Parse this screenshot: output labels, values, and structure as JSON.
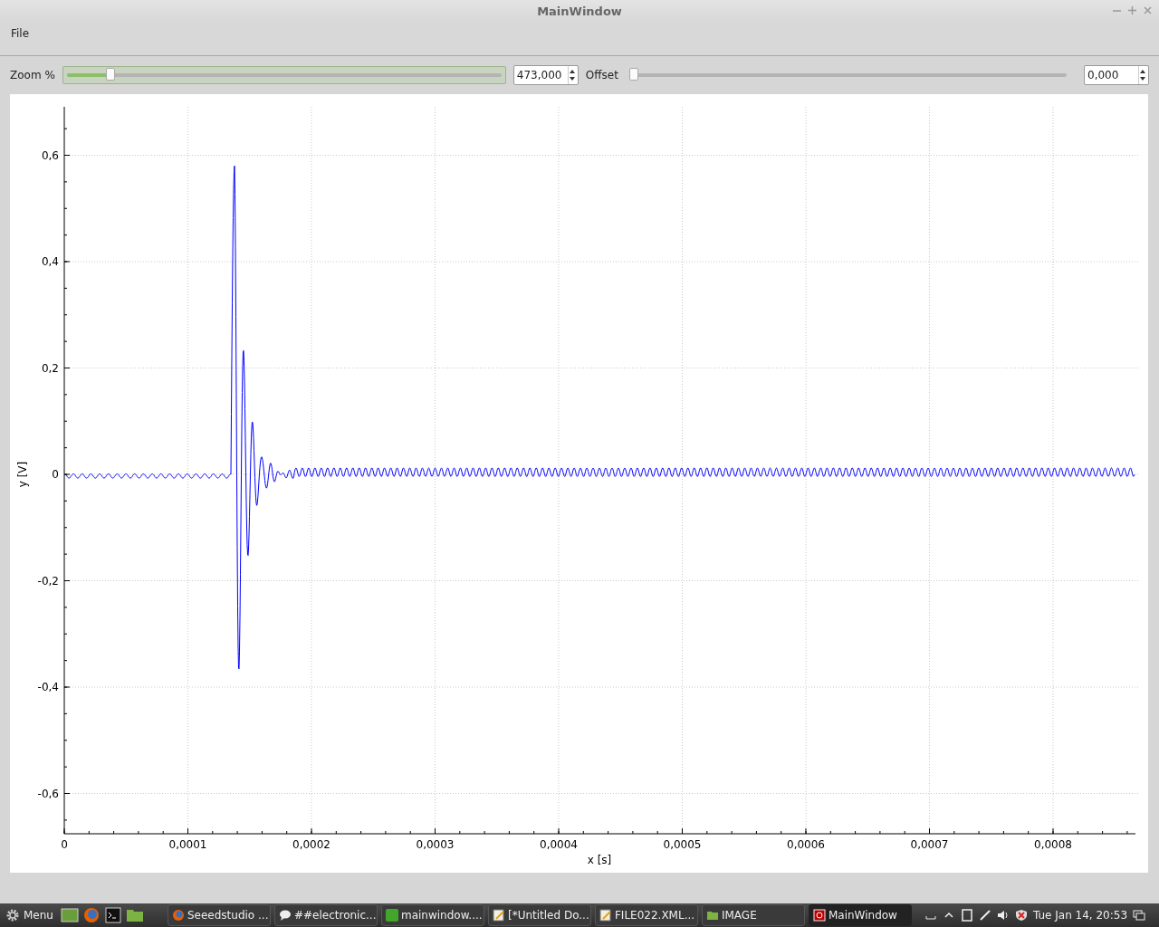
{
  "window": {
    "title": "MainWindow"
  },
  "menu": [
    "File"
  ],
  "controls": {
    "zoom": {
      "label": "Zoom %",
      "level": 0.1,
      "value": "473,000"
    },
    "offset": {
      "label": "Offset",
      "level": 0,
      "value": "0,000"
    }
  },
  "plot": {
    "ylabel": "y [V]",
    "xlabel": "x [s]",
    "yticks": [
      "0,6",
      "0,4",
      "0,2",
      "0",
      "-0,2",
      "-0,4",
      "-0,6"
    ],
    "xticks": [
      "0",
      "0,0001",
      "0,0002",
      "0,0003",
      "0,0004",
      "0,0005",
      "0,0006",
      "0,0007",
      "0,0008"
    ]
  },
  "taskbar": {
    "menu": "Menu",
    "tasks": [
      {
        "label": "Seeedstudio ...",
        "kind": "browser",
        "selected": false
      },
      {
        "label": "##electronic...",
        "kind": "chat",
        "selected": false
      },
      {
        "label": "mainwindow....",
        "kind": "qt",
        "selected": false
      },
      {
        "label": "[*Untitled Do...",
        "kind": "editor",
        "selected": false
      },
      {
        "label": "FILE022.XML...",
        "kind": "editor",
        "selected": false
      },
      {
        "label": "IMAGE",
        "kind": "folder",
        "selected": false
      },
      {
        "label": "MainWindow",
        "kind": "app",
        "selected": true
      }
    ],
    "clock": "Tue Jan 14, 20:53"
  }
}
